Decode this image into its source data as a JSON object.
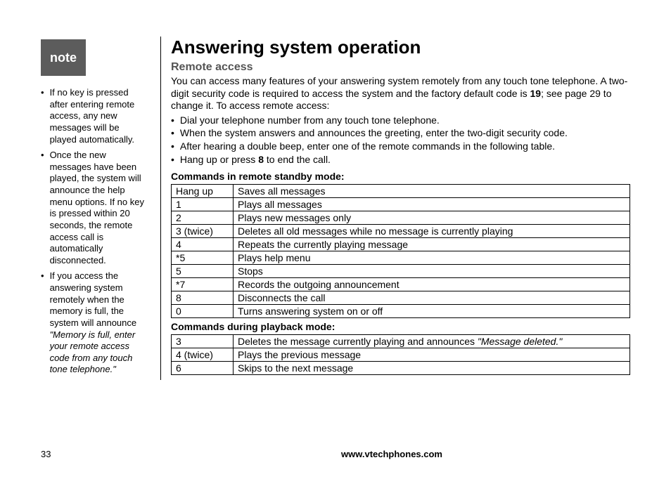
{
  "sidebar": {
    "label": "note",
    "items": [
      {
        "text": "If no key is pressed after entering remote access, any new messages will be played automatically."
      },
      {
        "text": "Once the new messages have been played, the system will announce the help menu options. If no key is pressed within 20 seconds, the remote access call is automatically disconnected."
      },
      {
        "prefix": "If you access the answering system remotely when the memory is full, the system will announce ",
        "italic": "\"Memory is full, enter your remote access code from any touch tone telephone.\""
      }
    ]
  },
  "main": {
    "title": "Answering system operation",
    "subtitle": "Remote access",
    "intro_part1": "You can access many features of your answering system remotely from any touch tone telephone. A two-digit security code is required to access the system and the factory default code is ",
    "intro_bold": "19",
    "intro_part2": "; see page 29 to change it. To access remote access:",
    "steps": [
      "Dial your telephone number from any touch tone telephone.",
      "When the system answers and announces the greeting, enter the two-digit security code.",
      "After hearing a double beep, enter one of the remote commands in the following table."
    ],
    "step4_a": "Hang up or press ",
    "step4_bold": "8",
    "step4_b": " to end the call.",
    "table1_title": "Commands in remote standby mode:",
    "table1": [
      {
        "key": "Hang up",
        "val": "Saves all messages"
      },
      {
        "key": "1",
        "val": "Plays all messages"
      },
      {
        "key": "2",
        "val": "Plays new messages only"
      },
      {
        "key": "3 (twice)",
        "val": "Deletes all old messages while no message is currently playing"
      },
      {
        "key": "4",
        "val": "Repeats the currently playing message"
      },
      {
        "key": "*5",
        "val": "Plays help menu"
      },
      {
        "key": "5",
        "val": "Stops"
      },
      {
        "key": "*7",
        "val": "Records the outgoing announcement"
      },
      {
        "key": "8",
        "val": "Disconnects the call"
      },
      {
        "key": "0",
        "val": "Turns answering system on or off"
      }
    ],
    "table2_title": "Commands during playback mode:",
    "table2": [
      {
        "key": "3",
        "val_a": "Deletes the message currently playing and announces ",
        "val_italic": "\"Message deleted.\""
      },
      {
        "key": "4 (twice)",
        "val": "Plays the previous message"
      },
      {
        "key": "6",
        "val": "Skips to the next message"
      }
    ]
  },
  "footer": {
    "page": "33",
    "url": "www.vtechphones.com"
  }
}
